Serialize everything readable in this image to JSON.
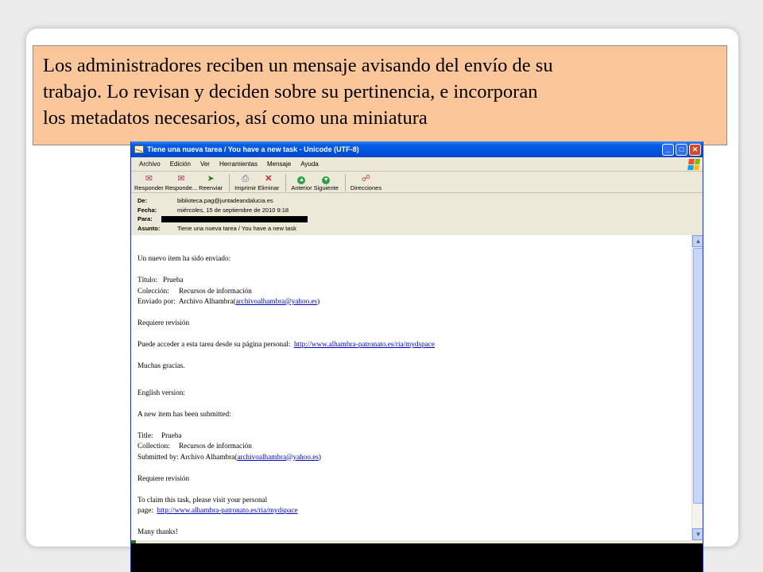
{
  "caption": {
    "line1": "Los administradores reciben un mensaje avisando del envío de su",
    "line2": "trabajo. Lo revisan y deciden sobre su pertinencia,  e incorporan",
    "line3": "los metadatos necesarios, así como una miniatura"
  },
  "window": {
    "title": "Tiene una nueva tarea / You have a new task - Unicode (UTF-8)",
    "controls": {
      "minimize": "_",
      "maximize": "□",
      "close": "✕"
    }
  },
  "menu": [
    "Archivo",
    "Edición",
    "Ver",
    "Herramientas",
    "Mensaje",
    "Ayuda"
  ],
  "toolbar": [
    {
      "label": "Responder",
      "icon": "reply-icon"
    },
    {
      "label": "Responde...",
      "icon": "reply-all-icon"
    },
    {
      "label": "Reenviar",
      "icon": "forward-icon"
    },
    {
      "label": "Imprimir",
      "icon": "print-icon"
    },
    {
      "label": "Eliminar",
      "icon": "delete-icon"
    },
    {
      "label": "Anterior",
      "icon": "previous-icon"
    },
    {
      "label": "Siguiente",
      "icon": "next-icon"
    },
    {
      "label": "Direcciones",
      "icon": "addresses-icon"
    }
  ],
  "headers": {
    "from_label": "De:",
    "from_value": "biblioteca.pag@juntadeandalucia.es",
    "date_label": "Fecha:",
    "date_value": "miércoles, 15 de septiembre de 2010 9:18",
    "to_label": "Para:",
    "subject_label": "Asunto:",
    "subject_value": "Tiene una nueva tarea / You have a new task"
  },
  "email": {
    "intro_es": "Un nuevo ítem ha sido enviado:",
    "title_label_es": "Título:",
    "title_value_es": "Prueba",
    "collection_label_es": "Colección:",
    "collection_value_es": "Recursos de información",
    "sent_by_label_es": "Enviado por:",
    "sent_by_name_es": "Archivo Alhambra",
    "sent_by_email_es": "archivoalhambra@yahoo.es",
    "review_es": "Requiere revisión",
    "access_text_es": "Puede acceder a esta tarea desde su página personal:",
    "access_link_es": "http://www.alhambra-patronato.es/ria/mydspace",
    "thanks_es": "Muchas gracias.",
    "english_heading": "English version:",
    "intro_en": "A new item has been submitted:",
    "title_label_en": "Title:",
    "title_value_en": "Prueba",
    "collection_label_en": "Collection:",
    "collection_value_en": "Recursos de información",
    "submitted_label_en": "Submitted by:",
    "submitted_name_en": "Archivo Alhambra",
    "submitted_email_en": "archivoalhambra@yahoo.es",
    "review_en": "Requiere revisión",
    "claim_text_en": "To claim this task, please visit your personal",
    "page_label_en": "page:",
    "claim_link_en": "http://www.alhambra-patronato.es/ria/mydspace",
    "thanks_en": "Many thanks!"
  },
  "colors": {
    "caption_bg": "#fbc79a",
    "titlebar_blue": "#0054e3",
    "link": "#0000cc"
  }
}
